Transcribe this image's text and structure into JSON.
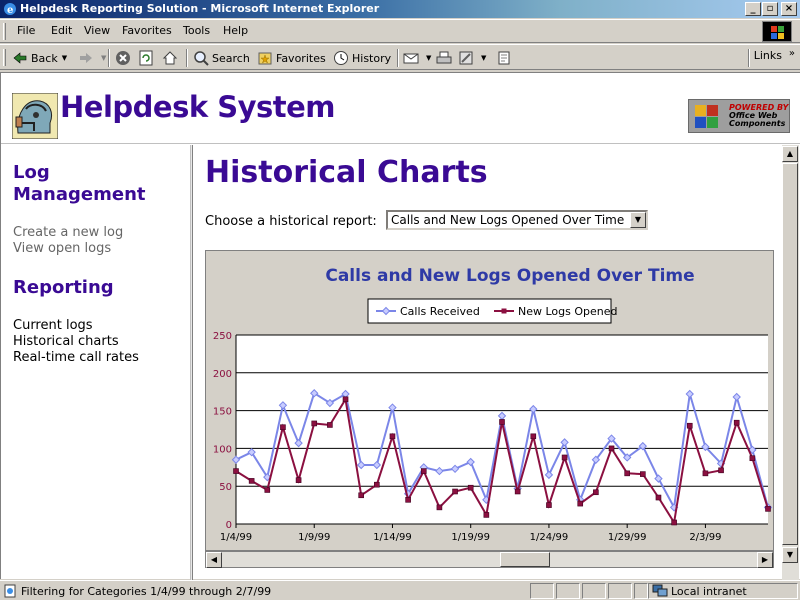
{
  "window": {
    "title": "Helpdesk Reporting Solution - Microsoft Internet Explorer"
  },
  "menu": [
    "File",
    "Edit",
    "View",
    "Favorites",
    "Tools",
    "Help"
  ],
  "toolbar": {
    "back": "Back",
    "search": "Search",
    "favorites": "Favorites",
    "history": "History",
    "links": "Links"
  },
  "header": {
    "site_title": "Helpdesk System",
    "badge_line1": "POWERED BY",
    "badge_line2": "Office Web Components"
  },
  "sidebar": {
    "log_heading": "Log Management",
    "log_links": [
      "Create a new log",
      "View open logs"
    ],
    "reporting_heading": "Reporting",
    "reporting_links": [
      "Current logs",
      "Historical charts",
      "Real-time call rates"
    ]
  },
  "main": {
    "title": "Historical Charts",
    "choose_label": "Choose a historical report:",
    "selected_report": "Calls and New Logs Opened Over Time"
  },
  "status": {
    "text": "Filtering for Categories 1/4/99 through 2/7/99",
    "zone": "Local intranet"
  },
  "colors": {
    "brand": "#3a0a94",
    "series1": "#7b86e8",
    "series2": "#8b1040",
    "chart_title": "#2e3aa6"
  },
  "chart_data": {
    "type": "line",
    "title": "Calls and New Logs Opened Over Time",
    "xlabel": "",
    "ylabel": "",
    "ylim": [
      0,
      250
    ],
    "yticks": [
      0,
      50,
      100,
      150,
      200,
      250
    ],
    "grid": true,
    "legend": "top",
    "x_tick_labels": [
      "1/4/99",
      "1/9/99",
      "1/14/99",
      "1/19/99",
      "1/24/99",
      "1/29/99",
      "2/3/99"
    ],
    "x": [
      "1/4/99",
      "1/5/99",
      "1/6/99",
      "1/7/99",
      "1/8/99",
      "1/9/99",
      "1/10/99",
      "1/11/99",
      "1/12/99",
      "1/13/99",
      "1/14/99",
      "1/15/99",
      "1/16/99",
      "1/17/99",
      "1/18/99",
      "1/19/99",
      "1/20/99",
      "1/21/99",
      "1/22/99",
      "1/23/99",
      "1/24/99",
      "1/25/99",
      "1/26/99",
      "1/27/99",
      "1/28/99",
      "1/29/99",
      "1/30/99",
      "1/31/99",
      "2/1/99",
      "2/2/99",
      "2/3/99",
      "2/4/99",
      "2/5/99",
      "2/6/99",
      "2/7/99"
    ],
    "series": [
      {
        "name": "Calls Received",
        "values": [
          85,
          95,
          62,
          157,
          107,
          173,
          160,
          172,
          78,
          78,
          154,
          40,
          75,
          70,
          73,
          82,
          32,
          143,
          47,
          152,
          65,
          108,
          32,
          85,
          113,
          88,
          103,
          60,
          22,
          172,
          102,
          80,
          168,
          98,
          22
        ]
      },
      {
        "name": "New Logs Opened",
        "values": [
          70,
          57,
          45,
          128,
          58,
          133,
          131,
          165,
          38,
          52,
          116,
          32,
          70,
          22,
          43,
          48,
          12,
          135,
          43,
          116,
          25,
          88,
          27,
          42,
          100,
          67,
          66,
          35,
          2,
          130,
          67,
          71,
          134,
          87,
          20
        ]
      }
    ]
  }
}
